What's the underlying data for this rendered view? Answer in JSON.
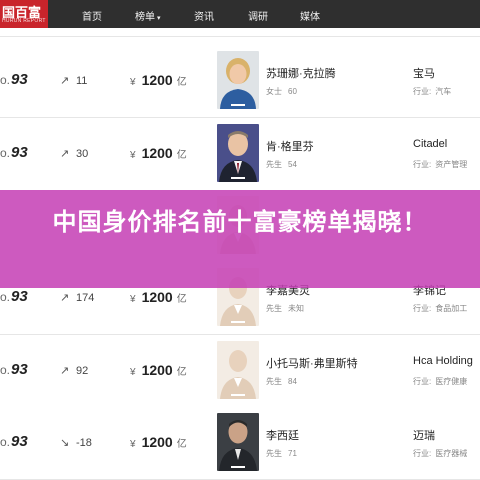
{
  "nav": {
    "logo_text": "国百富",
    "logo_subtext": "HURUN REPORT",
    "items": [
      "首页",
      "榜单",
      "资讯",
      "调研",
      "媒体"
    ],
    "dropdown_marker": "▾"
  },
  "wealth_unit": "亿",
  "currency": "¥",
  "rows": [
    {
      "score_prefix": "o.",
      "score": "93",
      "trend": "11",
      "trend_dir": "up",
      "wealth": "1200",
      "name": "苏珊娜·克拉腾",
      "gender": "女士",
      "age": "60",
      "company": "宝马",
      "industry_label": "行业:",
      "industry": "汽车",
      "portrait": "woman-blonde"
    },
    {
      "score_prefix": "o.",
      "score": "93",
      "trend": "30",
      "trend_dir": "up",
      "wealth": "1200",
      "name": "肯·格里芬",
      "gender": "先生",
      "age": "54",
      "company": "Citadel",
      "industry_label": "行业:",
      "industry": "资产管理",
      "portrait": "man-suit"
    },
    {
      "score_prefix": "o.",
      "score": "93",
      "trend": "174",
      "trend_dir": "up",
      "wealth": "1200",
      "name": "李嘉美灵",
      "gender": "先生",
      "age": "未知",
      "company": "李锦记",
      "industry_label": "行业:",
      "industry": "食品加工",
      "portrait": "placeholder"
    },
    {
      "score_prefix": "o.",
      "score": "93",
      "trend": "92",
      "trend_dir": "up",
      "wealth": "1200",
      "name": "小托马斯·弗里斯特",
      "gender": "先生",
      "age": "84",
      "company": "Hca Holding",
      "industry_label": "行业:",
      "industry": "医疗健康",
      "portrait": "placeholder"
    },
    {
      "score_prefix": "o.",
      "score": "93",
      "trend": "-18",
      "trend_dir": "down",
      "wealth": "1200",
      "name": "李西廷",
      "gender": "先生",
      "age": "71",
      "company": "迈瑞",
      "industry_label": "行业:",
      "industry": "医疗器械",
      "portrait": "man-dark"
    }
  ],
  "banner": {
    "text": "中国身价排名前十富豪榜单揭晓！"
  },
  "colors": {
    "banner": "#c53fb4",
    "nav_bg": "#2f2f2f",
    "logo_bg": "#c9242b"
  }
}
